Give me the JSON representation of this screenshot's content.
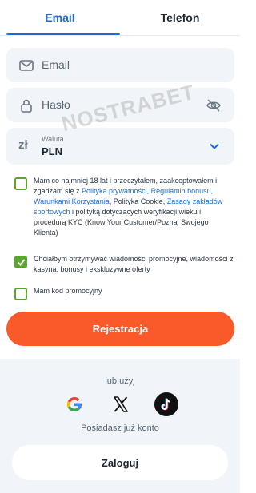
{
  "tabs": {
    "email": "Email",
    "phone": "Telefon"
  },
  "email_field": {
    "placeholder": "Email"
  },
  "password_field": {
    "placeholder": "Hasło"
  },
  "currency": {
    "symbol": "zł",
    "label": "Waluta",
    "value": "PLN"
  },
  "consents": {
    "terms": {
      "checked": false,
      "parts": [
        "Mam co najmniej 18 lat i przeczytałem, zaakceptowałem i zgadzam się z ",
        "Polityka prywatności",
        ", ",
        "Regulamin bonusu",
        ", ",
        "Warunkami Korzystania",
        ", Polityka Cookie, ",
        "Zasady zakładów sportowych",
        " i polityką dotyczących weryfikacji wieku i procedurą KYC (Know Your Customer/Poznaj Swojego Klienta)"
      ]
    },
    "promo": {
      "checked": true,
      "text": "Chciałbym otrzymywać wiadomości promocyjne, wiadomości z kasyna, bonusy i ekskluzywne oferty"
    },
    "promo_code": {
      "checked": false,
      "text": "Mam kod promocyjny"
    }
  },
  "register_button": "Rejestracja",
  "social": {
    "or_text": "lub użyj",
    "providers": [
      "google-icon",
      "x-icon",
      "tiktok-icon"
    ]
  },
  "have_account": "Posiadasz już konto",
  "login_button": "Zaloguj",
  "watermark": "NOSTRABET",
  "colors": {
    "accent": "#1e6bd6",
    "orange": "#fa5a2a",
    "green": "#5aa62f",
    "field_bg": "#f1f4f8"
  }
}
